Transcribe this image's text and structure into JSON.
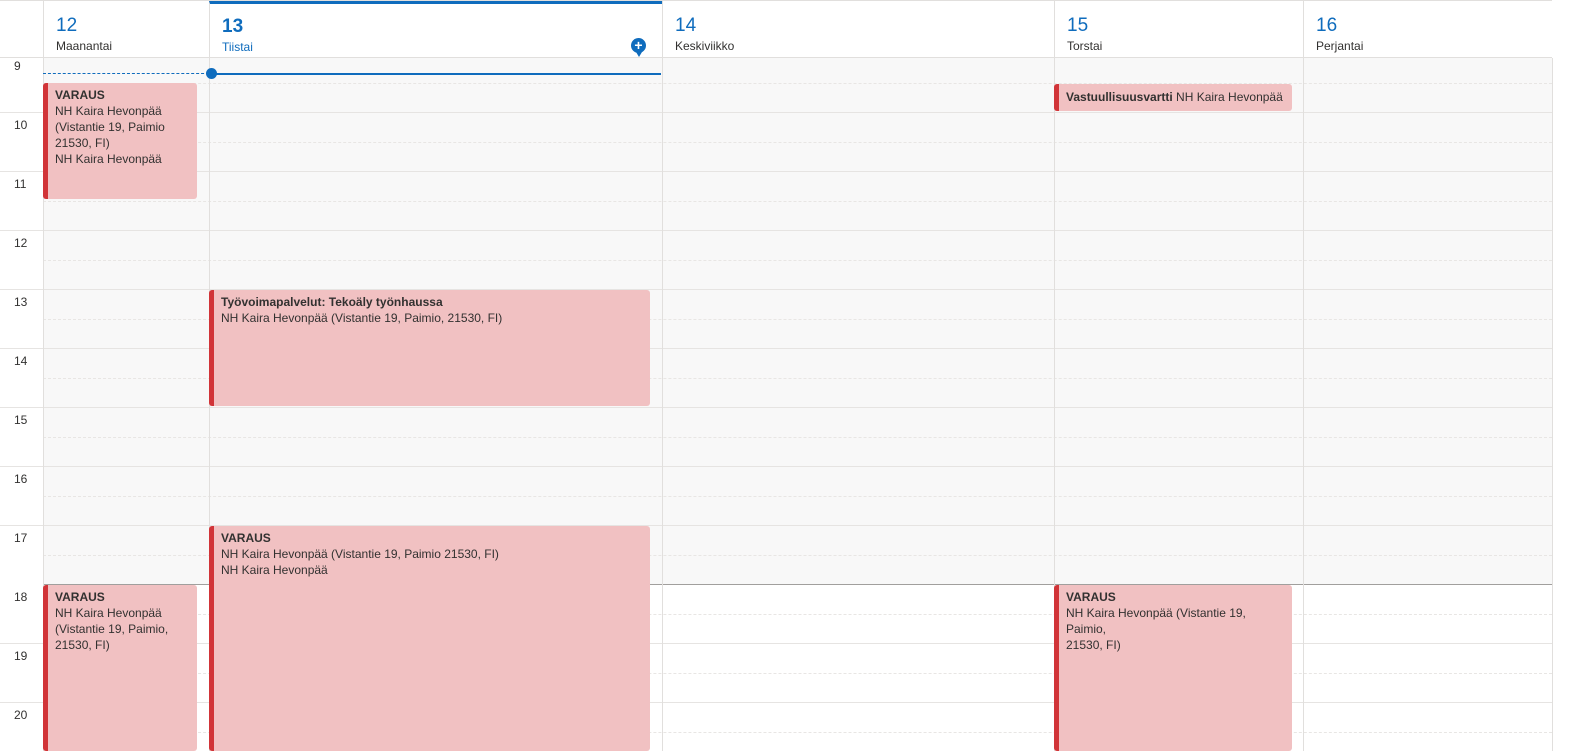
{
  "days": [
    {
      "num": "12",
      "name": "Maanantai"
    },
    {
      "num": "13",
      "name": "Tiistai"
    },
    {
      "num": "14",
      "name": "Keskiviikko"
    },
    {
      "num": "15",
      "name": "Torstai"
    },
    {
      "num": "16",
      "name": "Perjantai"
    }
  ],
  "add_event_icon": "+",
  "hours": [
    "9",
    "10",
    "11",
    "12",
    "13",
    "14",
    "15",
    "16",
    "17",
    "18",
    "19",
    "20"
  ],
  "events": {
    "mon_morning": {
      "title": "VARAUS",
      "line1": "NH Kaira Hevonpää",
      "line2": "(Vistantie 19, Paimio",
      "line3": "21530, FI)",
      "line4": "NH Kaira Hevonpää"
    },
    "tue_afternoon": {
      "title": "Työvoimapalvelut: Tekoäly työnhaussa",
      "line1": "NH Kaira Hevonpää (Vistantie 19, Paimio, 21530, FI)"
    },
    "tue_evening": {
      "title": "VARAUS",
      "line1": "NH Kaira Hevonpää (Vistantie 19, Paimio 21530, FI)",
      "line2": "NH Kaira Hevonpää"
    },
    "thu_morning": {
      "title": "Vastuullisuusvartti",
      "location": "NH Kaira Hevonpää"
    },
    "mon_evening": {
      "title": "VARAUS",
      "line1": "NH Kaira Hevonpää",
      "line2": "(Vistantie 19, Paimio,",
      "line3": "21530, FI)"
    },
    "thu_evening": {
      "title": "VARAUS",
      "line1": "NH Kaira Hevonpää (Vistantie 19, Paimio,",
      "line2": "21530, FI)"
    }
  },
  "colors": {
    "accent": "#0f6cbd",
    "event_bg": "#f1c1c2",
    "event_border": "#d13438"
  }
}
